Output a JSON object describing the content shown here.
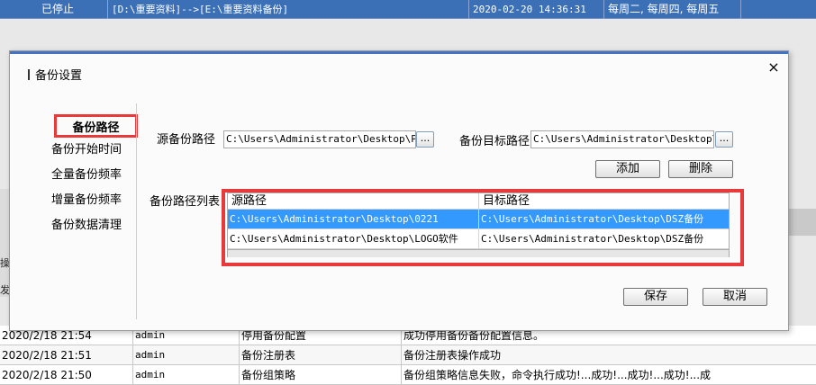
{
  "background": {
    "top_row": {
      "status": "已停止",
      "paths": "[D:\\重要资料]-->[E:\\重要资料备份]",
      "time": "2020-02-20 14:36:31",
      "schedule": "每周二, 每周四, 每周五"
    },
    "side_labels": [
      "操",
      "发"
    ],
    "log_rows": [
      {
        "time": "2020/2/18 21:54",
        "user": "admin",
        "action": "停用备份配置",
        "result": "成功停用备份备份配置信息。"
      },
      {
        "time": "2020/2/18 21:51",
        "user": "admin",
        "action": "备份注册表",
        "result": "备份注册表操作成功"
      },
      {
        "time": "2020/2/18 21:50",
        "user": "admin",
        "action": "备份组策略",
        "result": "备份组策略信息失败，命令执行成功!...成功!...成功!...成功!...成"
      }
    ]
  },
  "dialog": {
    "title": "备份设置",
    "close": "×",
    "nav": [
      "备份路径",
      "备份开始时间",
      "全量备份频率",
      "增量备份频率",
      "备份数据清理"
    ],
    "source_label": "源备份路径",
    "source_value": "C:\\Users\\Administrator\\Desktop\\PDF转",
    "target_label": "备份目标路径",
    "target_value": "C:\\Users\\Administrator\\Desktop\\DSZ",
    "browse": "...",
    "add_button": "添加",
    "delete_button": "删除",
    "list_label": "备份路径列表",
    "columns": [
      "源路径",
      "目标路径"
    ],
    "rows": [
      {
        "source": "C:\\Users\\Administrator\\Desktop\\0221",
        "target": "C:\\Users\\Administrator\\Desktop\\DSZ备份",
        "selected": true
      },
      {
        "source": "C:\\Users\\Administrator\\Desktop\\LOGO软件",
        "target": "C:\\Users\\Administrator\\Desktop\\DSZ备份",
        "selected": false
      }
    ],
    "save_button": "保存",
    "cancel_button": "取消"
  },
  "colors": {
    "highlight": "#e83a3a",
    "selection": "#3399ff",
    "title_bar": "#3b6fb6"
  }
}
